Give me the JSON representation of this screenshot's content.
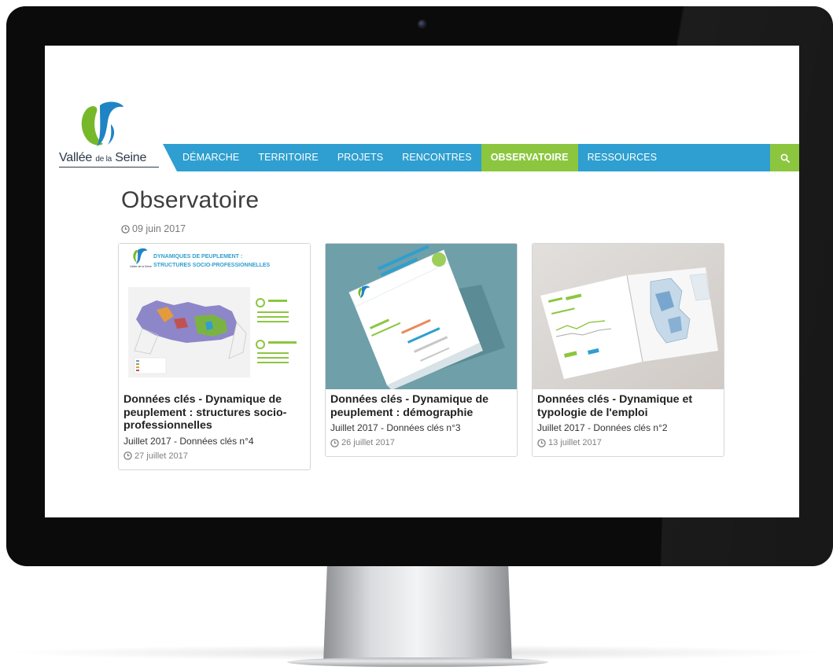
{
  "site": {
    "logo": {
      "name_main": "Vallée",
      "name_small": "de la",
      "name_end": "Seine"
    }
  },
  "nav": {
    "items": [
      {
        "label": "DÉMARCHE",
        "active": false
      },
      {
        "label": "TERRITOIRE",
        "active": false
      },
      {
        "label": "PROJETS",
        "active": false
      },
      {
        "label": "RENCONTRES",
        "active": false
      },
      {
        "label": "OBSERVATOIRE",
        "active": true
      },
      {
        "label": "RESSOURCES",
        "active": false
      }
    ],
    "search_icon": "search-icon"
  },
  "page": {
    "title": "Observatoire",
    "date": "09 juin 2017"
  },
  "cards": [
    {
      "title": "Données clés - Dynamique de peuplement : structures socio-professionnelles",
      "subtitle": "Juillet 2017 - Données clés n°4",
      "date": "27 juillet 2017",
      "thumb_heading_1": "DYNAMIQUES DE PEUPLEMENT :",
      "thumb_heading_2": "STRUCTURES SOCIO-PROFESSIONNELLES"
    },
    {
      "title": "Données clés - Dynamique de peuplement : démographie",
      "subtitle": "Juillet 2017 - Données clés n°3",
      "date": "26 juillet 2017"
    },
    {
      "title": "Données clés - Dynamique et typologie de l'emploi",
      "subtitle": "Juillet 2017 - Données clés n°2",
      "date": "13 juillet 2017"
    }
  ],
  "colors": {
    "nav_blue": "#2e9fd0",
    "nav_active_green": "#8cc63f",
    "logo_blue": "#1f84c4",
    "logo_green": "#77b82a"
  }
}
